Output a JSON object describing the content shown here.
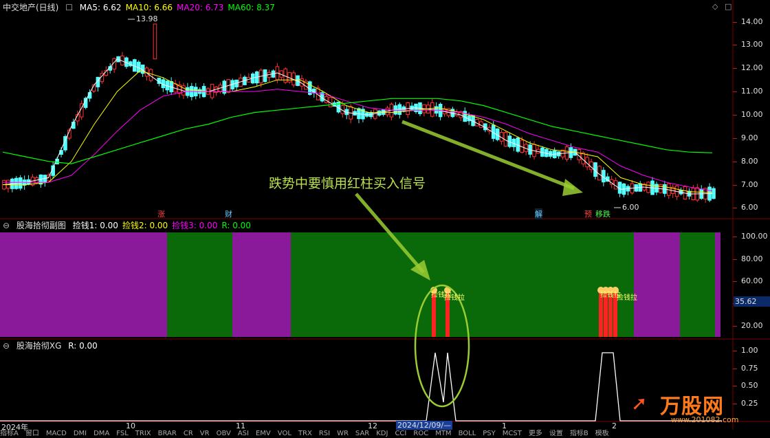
{
  "main_panel": {
    "title": "中交地产(日线)",
    "ma": [
      {
        "label": "MA5: 6.62",
        "color": "#ffffff"
      },
      {
        "label": "MA10: 6.66",
        "color": "#ffff00"
      },
      {
        "label": "MA20: 6.73",
        "color": "#ff00ff"
      },
      {
        "label": "MA60: 8.37",
        "color": "#00ff00"
      }
    ],
    "high_label": "13.98",
    "low_label": "6.00",
    "annotation": "跌势中要慎用红柱买入信号",
    "event_tags": [
      "涨",
      "财",
      "解",
      "预",
      "移跌"
    ]
  },
  "sub_panel1": {
    "title": "股海拾彻副图",
    "values": [
      {
        "label": "捡钱1: 0.00",
        "color": "#ffffff"
      },
      {
        "label": "捡钱2: 0.00",
        "color": "#ffff00"
      },
      {
        "label": "捡钱3: 0.00",
        "color": "#ff00ff"
      },
      {
        "label": "R: 0.00",
        "color": "#00ff00"
      }
    ],
    "current_value": "35.62",
    "signal_text": "捡钱拉"
  },
  "sub_panel2": {
    "title": "股海拾彻XG",
    "value": "R: 0.00"
  },
  "time_axis": {
    "labels": [
      "2024年",
      "10",
      "11",
      "12",
      "2024/12/09/—",
      "1",
      "2"
    ]
  },
  "bottom_tabs": [
    "指标A",
    "窗口",
    "MACD",
    "DMI",
    "DMA",
    "FSL",
    "TRIX",
    "BRAR",
    "CR",
    "VR",
    "OBV",
    "ASI",
    "EMV",
    "VOL",
    "TRX",
    "RSI",
    "WR",
    "SAR",
    "KDJ",
    "CCI",
    "ROC",
    "MTM",
    "BOLL",
    "PSY",
    "MCST",
    "更多",
    "设置",
    "指标B",
    "模板"
  ],
  "watermark": {
    "brand": "万股网",
    "site": "www.201082.com"
  },
  "chart_data": [
    {
      "type": "line",
      "title": "中交地产(日线)",
      "yaxis_ticks": [
        14.0,
        13.0,
        12.0,
        11.0,
        10.0,
        9.0,
        8.0,
        7.0,
        6.0
      ],
      "ylim": [
        5.6,
        14.4
      ],
      "series": [
        {
          "name": "MA5",
          "color": "#ffffff",
          "values": [
            7.0,
            7.1,
            7.3,
            9.5,
            11.3,
            12.4,
            12.0,
            11.3,
            11.0,
            11.0,
            11.3,
            11.6,
            11.8,
            11.4,
            10.7,
            10.1,
            10.0,
            10.2,
            10.3,
            10.2,
            10.0,
            9.5,
            8.9,
            8.5,
            8.3,
            8.4,
            7.5,
            6.8,
            6.9,
            6.8,
            6.6,
            6.62
          ]
        },
        {
          "name": "MA10",
          "color": "#ffff00",
          "values": [
            7.0,
            7.0,
            7.1,
            8.0,
            9.6,
            11.0,
            11.9,
            11.6,
            11.1,
            11.0,
            11.0,
            11.2,
            11.5,
            11.5,
            11.0,
            10.4,
            10.1,
            10.1,
            10.2,
            10.3,
            10.1,
            9.8,
            9.3,
            8.8,
            8.5,
            8.4,
            8.2,
            7.3,
            7.0,
            6.9,
            6.7,
            6.66
          ]
        },
        {
          "name": "MA20",
          "color": "#ff00ff",
          "values": [
            7.1,
            7.1,
            7.1,
            7.4,
            8.3,
            9.3,
            10.2,
            10.8,
            11.0,
            11.0,
            11.0,
            11.0,
            11.1,
            11.0,
            10.9,
            10.6,
            10.3,
            10.2,
            10.2,
            10.2,
            10.1,
            9.9,
            9.6,
            9.2,
            8.9,
            8.6,
            8.4,
            7.8,
            7.4,
            7.1,
            6.9,
            6.73
          ]
        },
        {
          "name": "MA60",
          "color": "#00ff00",
          "values": [
            8.4,
            8.2,
            8.0,
            7.9,
            8.2,
            8.5,
            8.8,
            9.1,
            9.4,
            9.6,
            9.9,
            10.1,
            10.2,
            10.3,
            10.4,
            10.5,
            10.6,
            10.7,
            10.7,
            10.7,
            10.6,
            10.4,
            10.1,
            9.8,
            9.5,
            9.3,
            9.1,
            8.9,
            8.7,
            8.5,
            8.4,
            8.37
          ]
        }
      ]
    },
    {
      "type": "bar",
      "title": "股海拾彻副图",
      "yaxis_ticks": [
        100.0,
        80.0,
        60.0,
        40.0,
        20.0
      ],
      "ylim": [
        10,
        105
      ],
      "current_value": 35.62
    },
    {
      "type": "line",
      "title": "股海拾彻XG",
      "yaxis_ticks": [
        1.0,
        0.75,
        0.5,
        0.25
      ],
      "ylim": [
        0,
        1.05
      ]
    }
  ]
}
